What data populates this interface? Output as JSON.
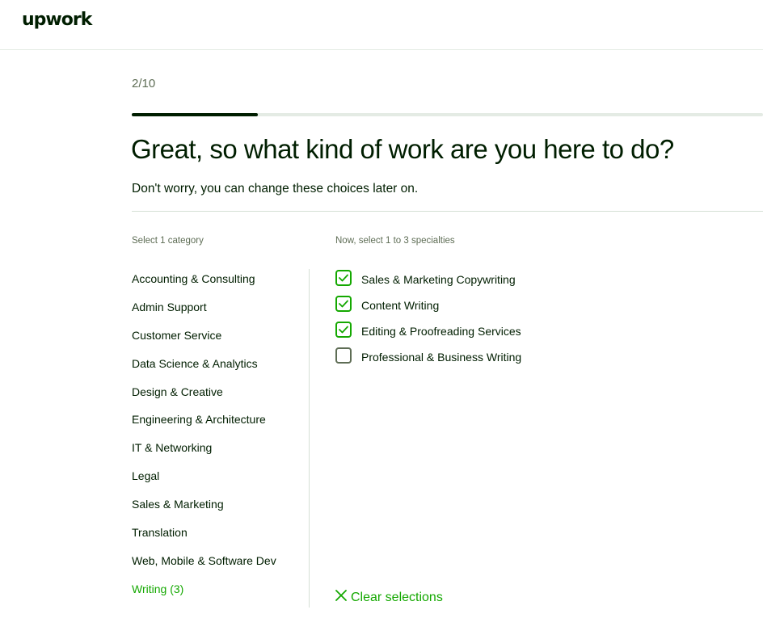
{
  "header": {
    "logo_text": "upwork"
  },
  "progress": {
    "step_label": "2/10",
    "fraction": 0.2
  },
  "main": {
    "title": "Great, so what kind of work are you here to do?",
    "subtitle": "Don't worry, you can change these choices later on."
  },
  "categories": {
    "label": "Select 1 category",
    "items": [
      {
        "label": "Accounting & Consulting",
        "active": false
      },
      {
        "label": "Admin Support",
        "active": false
      },
      {
        "label": "Customer Service",
        "active": false
      },
      {
        "label": "Data Science & Analytics",
        "active": false
      },
      {
        "label": "Design & Creative",
        "active": false
      },
      {
        "label": "Engineering & Architecture",
        "active": false
      },
      {
        "label": "IT & Networking",
        "active": false
      },
      {
        "label": "Legal",
        "active": false
      },
      {
        "label": "Sales & Marketing",
        "active": false
      },
      {
        "label": "Translation",
        "active": false
      },
      {
        "label": "Web, Mobile & Software Dev",
        "active": false
      },
      {
        "label": "Writing (3)",
        "active": true
      }
    ]
  },
  "specialties": {
    "label": "Now, select 1 to 3 specialties",
    "items": [
      {
        "label": "Sales & Marketing Copywriting",
        "checked": true
      },
      {
        "label": "Content Writing",
        "checked": true
      },
      {
        "label": "Editing & Proofreading Services",
        "checked": true
      },
      {
        "label": "Professional & Business Writing",
        "checked": false
      }
    ],
    "clear_label": "Clear selections"
  },
  "colors": {
    "brand_green": "#14a800",
    "text_dark": "#001e00",
    "text_muted": "#5e6d55"
  }
}
